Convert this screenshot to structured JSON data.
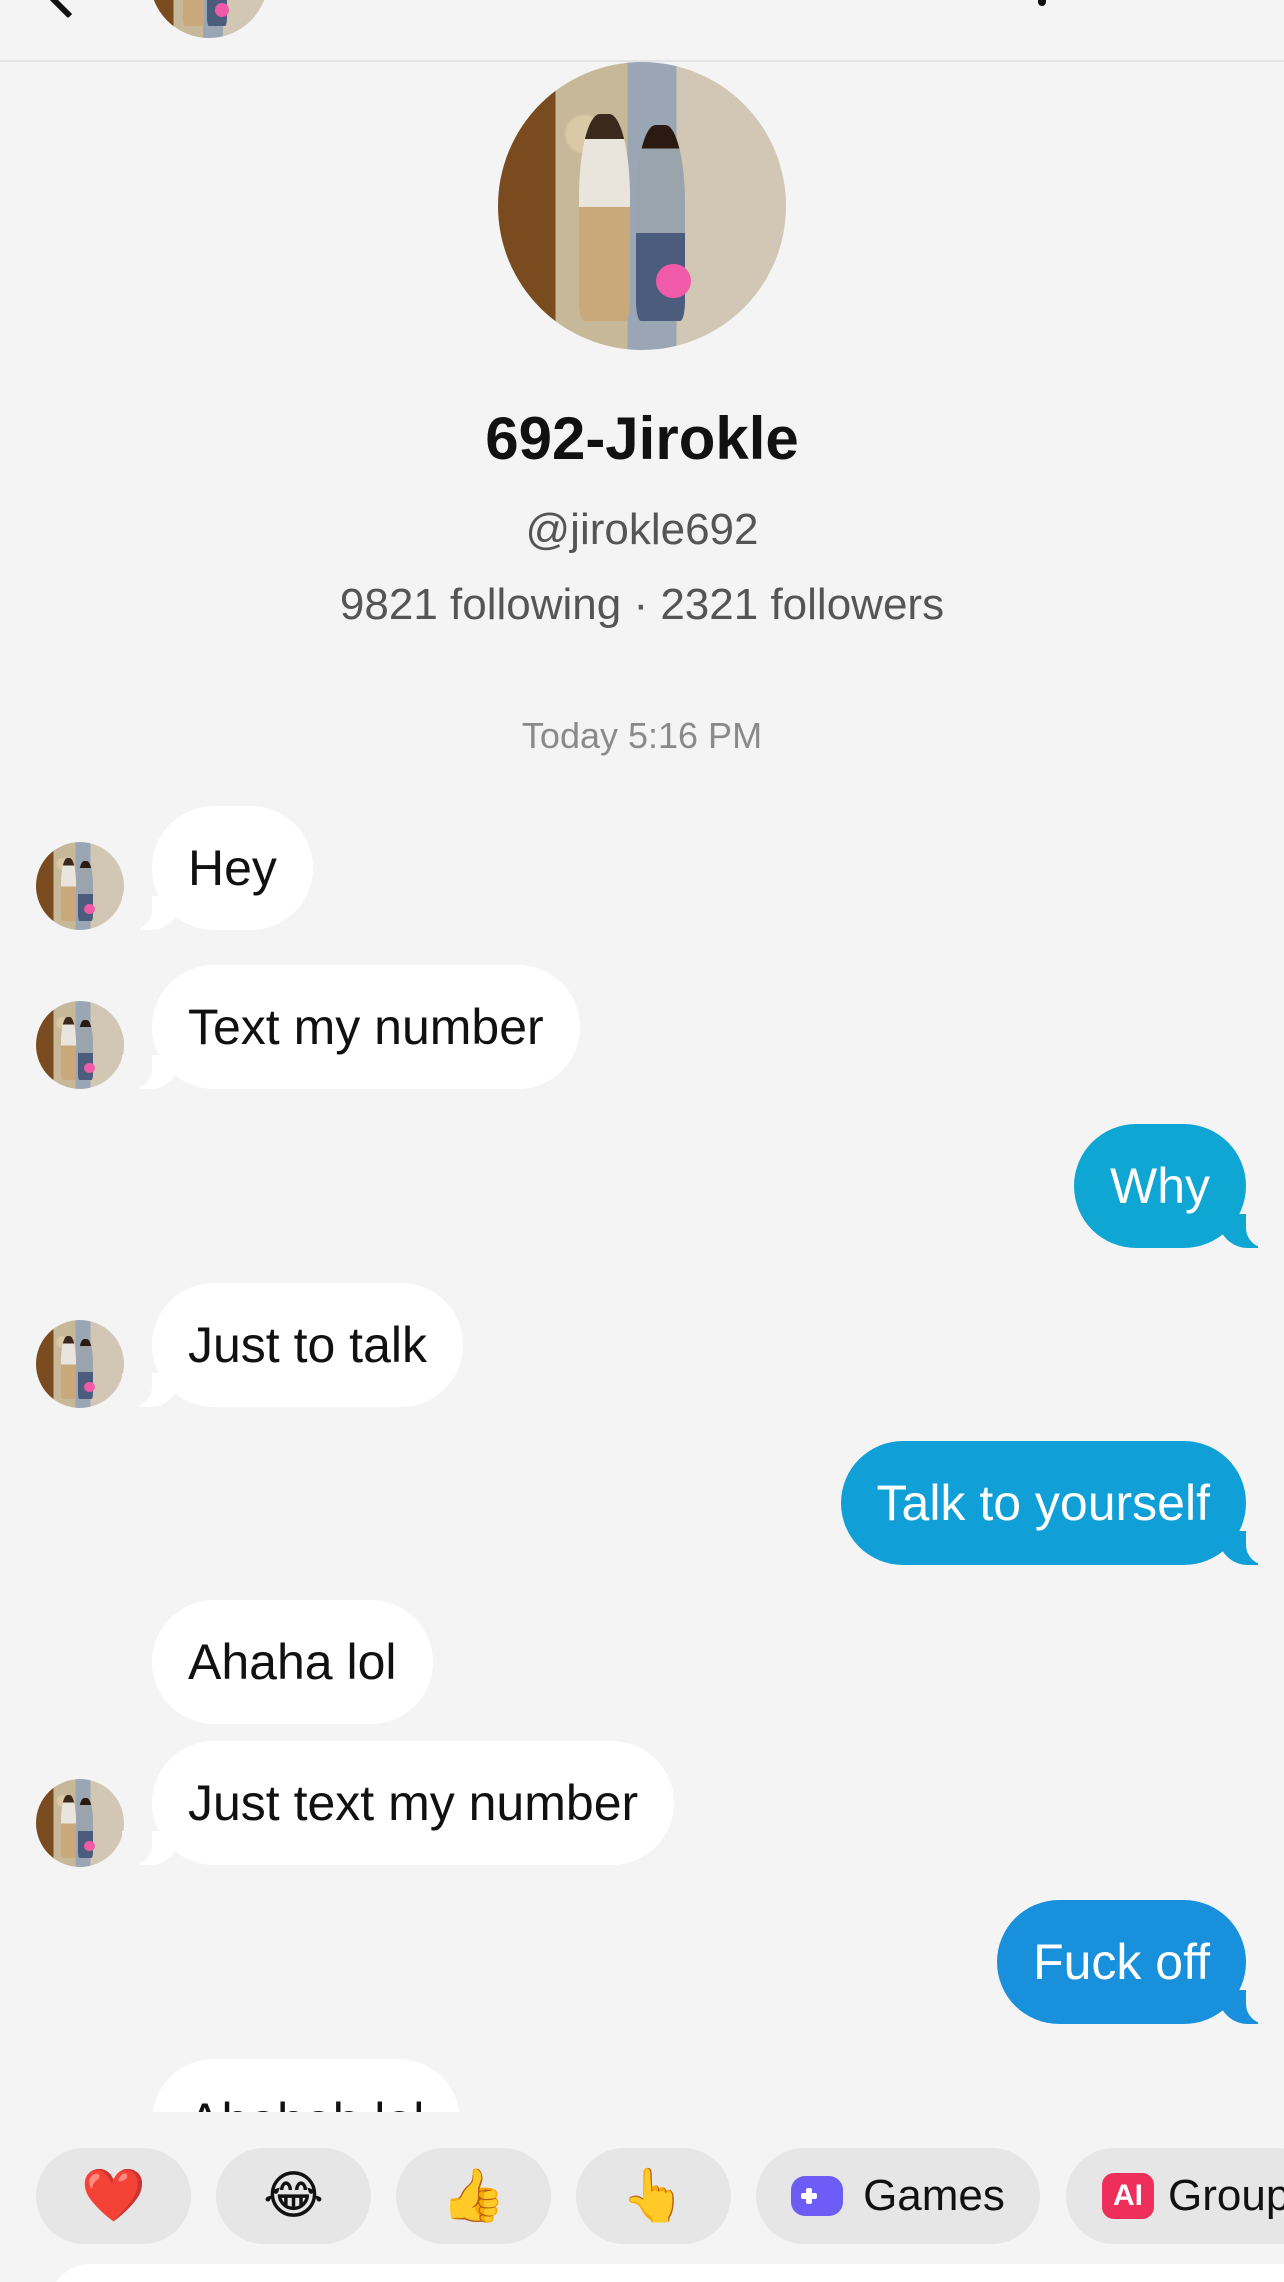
{
  "header": {
    "back_icon": "chevron-left-icon",
    "avatar": "profile-photo"
  },
  "profile": {
    "name": "692-Jirokle",
    "handle": "@jirokle692",
    "stats": "9821 following · 2321 followers"
  },
  "chat": {
    "timestamp": "Today 5:16 PM",
    "messages": [
      {
        "dir": "in",
        "text": "Hey"
      },
      {
        "dir": "in",
        "text": "Text my number"
      },
      {
        "dir": "out",
        "text": "Why",
        "color": "#10a6d4"
      },
      {
        "dir": "in",
        "text": "Just to talk"
      },
      {
        "dir": "out",
        "text": "Talk to yourself",
        "color": "#119fd8"
      },
      {
        "dir": "in",
        "text": "Ahaha lol"
      },
      {
        "dir": "in",
        "text": "Just text my number"
      },
      {
        "dir": "out",
        "text": "Fuck off",
        "color": "#1890dc"
      },
      {
        "dir": "in",
        "text": "Ahahah lol"
      }
    ]
  },
  "quick_replies": [
    {
      "kind": "emoji",
      "value": "❤️",
      "icon": "heart-icon"
    },
    {
      "kind": "emoji",
      "value": "😂",
      "icon": "laughing-face-icon"
    },
    {
      "kind": "emoji",
      "value": "👍",
      "icon": "thumbs-up-icon"
    },
    {
      "kind": "emoji",
      "value": "👆",
      "icon": "pointing-finger-icon"
    },
    {
      "kind": "label",
      "label": "Games",
      "icon": "game-controller-icon"
    },
    {
      "kind": "label",
      "label": "Group",
      "badge": "AI",
      "icon": "ai-icon"
    }
  ],
  "colors": {
    "background": "#f4f4f4",
    "incoming_bubble": "#ffffff",
    "outgoing_gradient_start": "#10a6d4",
    "outgoing_gradient_end": "#1890dc"
  }
}
